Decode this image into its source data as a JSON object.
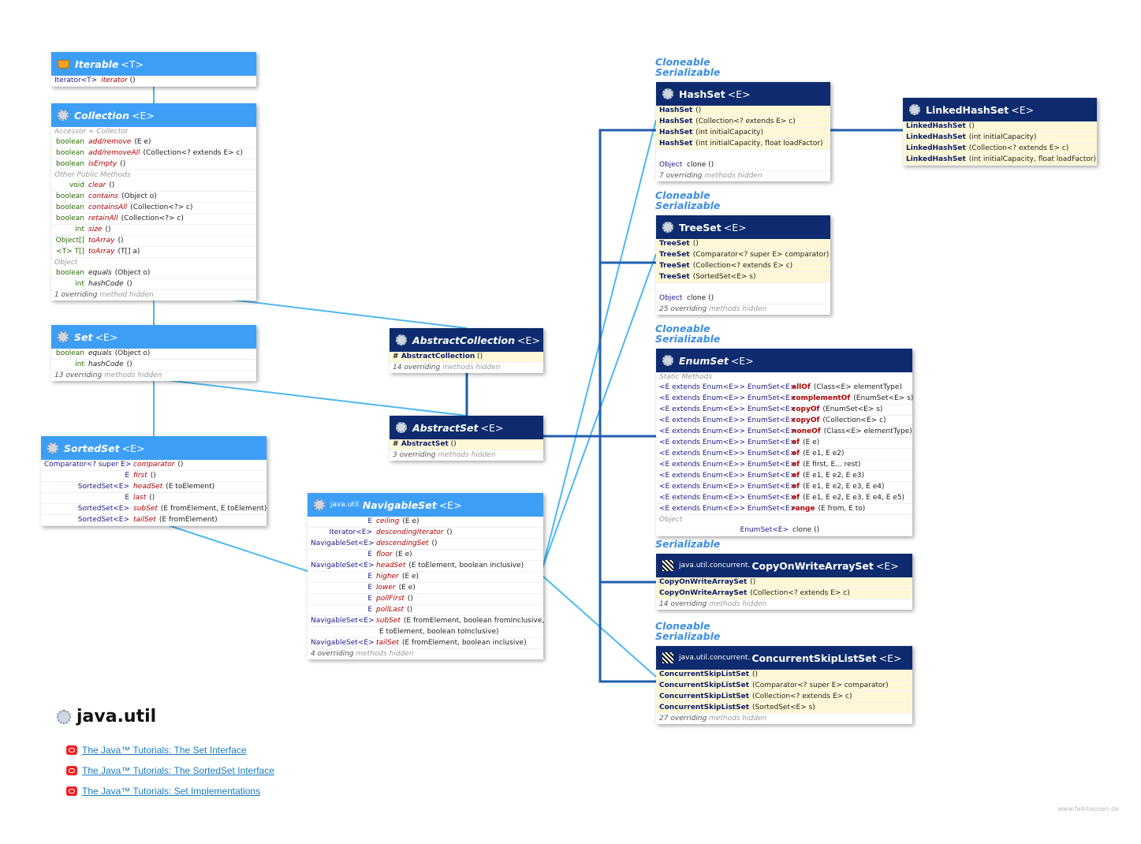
{
  "iterable": {
    "name": "Iterable",
    "tp": "<T>",
    "rows": [
      {
        "ret": "Iterator<T>",
        "m": "iterator",
        "a": "()"
      }
    ]
  },
  "collection": {
    "name": "Collection",
    "tp": "<E>",
    "sec1": "Accessor + Collector",
    "rows1": [
      {
        "ret": "boolean",
        "m": "add/remove",
        "a": "(E e)"
      },
      {
        "ret": "boolean",
        "m": "add/removeAll",
        "a": "(Collection<? extends E> c)"
      },
      {
        "ret": "boolean",
        "m": "isEmpty",
        "a": "()"
      }
    ],
    "sec2": "Other Public Methods",
    "rows2": [
      {
        "ret": "void",
        "m": "clear",
        "a": "()"
      },
      {
        "ret": "boolean",
        "m": "contains",
        "a": "(Object o)"
      },
      {
        "ret": "boolean",
        "m": "containsAll",
        "a": "(Collection<?> c)"
      },
      {
        "ret": "boolean",
        "m": "retainAll",
        "a": "(Collection<?> c)"
      },
      {
        "ret": "int",
        "m": "size",
        "a": "()"
      },
      {
        "ret": "Object[]",
        "m": "toArray",
        "a": "()"
      },
      {
        "ret": "<T> T[]",
        "m": "toArray",
        "a": "(T[] a)"
      }
    ],
    "sec3": "Object",
    "rows3": [
      {
        "ret": "boolean",
        "m": "equals",
        "a": "(Object o)"
      },
      {
        "ret": "int",
        "m": "hashCode",
        "a": "()"
      }
    ],
    "foot": "1 overriding",
    "foot2": "method hidden"
  },
  "set": {
    "name": "Set",
    "tp": "<E>",
    "rows": [
      {
        "ret": "boolean",
        "m": "equals",
        "a": "(Object o)"
      },
      {
        "ret": "int",
        "m": "hashCode",
        "a": "()"
      }
    ],
    "foot": "13 overriding",
    "foot2": "methods hidden"
  },
  "sortedset": {
    "name": "SortedSet",
    "tp": "<E>",
    "rows": [
      {
        "ret": "Comparator<? super E>",
        "m": "comparator",
        "a": "()"
      },
      {
        "ret": "E",
        "m": "first",
        "a": "()"
      },
      {
        "ret": "SortedSet<E>",
        "m": "headSet",
        "a": "(E toElement)"
      },
      {
        "ret": "E",
        "m": "last",
        "a": "()"
      },
      {
        "ret": "SortedSet<E>",
        "m": "subSet",
        "a": "(E fromElement, E toElement)"
      },
      {
        "ret": "SortedSet<E>",
        "m": "tailSet",
        "a": "(E fromElement)"
      }
    ]
  },
  "abstractcollection": {
    "name": "AbstractCollection",
    "tp": "<E>",
    "ctor": "AbstractCollection",
    "ctora": "()",
    "foot": "14 overriding",
    "foot2": "methods hidden"
  },
  "abstractset": {
    "name": "AbstractSet",
    "tp": "<E>",
    "ctor": "AbstractSet",
    "ctora": "()",
    "foot": "3 overriding",
    "foot2": "methods hidden"
  },
  "navigableset": {
    "pkg": "java.util.",
    "name": "NavigableSet",
    "tp": "<E>",
    "rows": [
      {
        "ret": "E",
        "m": "ceiling",
        "a": "(E e)"
      },
      {
        "ret": "Iterator<E>",
        "m": "descendingIterator",
        "a": "()"
      },
      {
        "ret": "NavigableSet<E>",
        "m": "descendingSet",
        "a": "()"
      },
      {
        "ret": "E",
        "m": "floor",
        "a": "(E e)"
      },
      {
        "ret": "NavigableSet<E>",
        "m": "headSet",
        "a": "(E toElement, boolean inclusive)"
      },
      {
        "ret": "E",
        "m": "higher",
        "a": "(E e)"
      },
      {
        "ret": "E",
        "m": "lower",
        "a": "(E e)"
      },
      {
        "ret": "E",
        "m": "pollFirst",
        "a": "()"
      },
      {
        "ret": "E",
        "m": "pollLast",
        "a": "()"
      },
      {
        "ret": "NavigableSet<E>",
        "m": "subSet",
        "a": "(E fromElement, boolean fromInclusive,"
      },
      {
        "ret": "",
        "m": "",
        "a": "E toElement, boolean toInclusive)"
      },
      {
        "ret": "NavigableSet<E>",
        "m": "tailSet",
        "a": "(E fromElement, boolean inclusive)"
      }
    ],
    "foot": "4 overriding",
    "foot2": "methods hidden"
  },
  "hashset": {
    "deco1": "Cloneable",
    "deco2": "Serializable",
    "name": "HashSet",
    "tp": "<E>",
    "ctors": [
      {
        "n": "HashSet",
        "a": "()"
      },
      {
        "n": "HashSet",
        "a": "(Collection<? extends E> c)"
      },
      {
        "n": "HashSet",
        "a": "(int initialCapacity)"
      },
      {
        "n": "HashSet",
        "a": "(int initialCapacity, float loadFactor)"
      }
    ],
    "rows": [
      {
        "ret": "Object",
        "m": "clone",
        "a": "()"
      }
    ],
    "foot": "7 overriding",
    "foot2": "methods hidden"
  },
  "linkedhashset": {
    "name": "LinkedHashSet",
    "tp": "<E>",
    "ctors": [
      {
        "n": "LinkedHashSet",
        "a": "()"
      },
      {
        "n": "LinkedHashSet",
        "a": "(int initialCapacity)"
      },
      {
        "n": "LinkedHashSet",
        "a": "(Collection<? extends E> c)"
      },
      {
        "n": "LinkedHashSet",
        "a": "(int initialCapacity, float loadFactor)"
      }
    ]
  },
  "treeset": {
    "deco1": "Cloneable",
    "deco2": "Serializable",
    "name": "TreeSet",
    "tp": "<E>",
    "ctors": [
      {
        "n": "TreeSet",
        "a": "()"
      },
      {
        "n": "TreeSet",
        "a": "(Comparator<? super E> comparator)"
      },
      {
        "n": "TreeSet",
        "a": "(Collection<? extends E> c)"
      },
      {
        "n": "TreeSet",
        "a": "(SortedSet<E> s)"
      }
    ],
    "rows": [
      {
        "ret": "Object",
        "m": "clone",
        "a": "()"
      }
    ],
    "foot": "25 overriding",
    "foot2": "methods hidden"
  },
  "enumset": {
    "deco1": "Cloneable",
    "deco2": "Serializable",
    "name": "EnumSet",
    "tp": "<E>",
    "sec1": "Static Methods",
    "pre": "<E extends Enum<E>> EnumSet<E>",
    "rows": [
      {
        "m": "allOf",
        "a": "(Class<E> elementType)"
      },
      {
        "m": "complementOf",
        "a": "(EnumSet<E> s)"
      },
      {
        "m": "copyOf",
        "a": "(EnumSet<E> s)"
      },
      {
        "m": "copyOf",
        "a": "(Collection<E> c)"
      },
      {
        "m": "noneOf",
        "a": "(Class<E> elementType)"
      },
      {
        "m": "of",
        "a": "(E e)"
      },
      {
        "m": "of",
        "a": "(E e1, E e2)"
      },
      {
        "m": "of",
        "a": "(E first, E... rest)"
      },
      {
        "m": "of",
        "a": "(E e1, E e2, E e3)"
      },
      {
        "m": "of",
        "a": "(E e1, E e2, E e3, E e4)"
      },
      {
        "m": "of",
        "a": "(E e1, E e2, E e3, E e4, E e5)"
      },
      {
        "m": "range",
        "a": "(E from, E to)"
      }
    ],
    "sec2": "Object",
    "clone": {
      "ret": "EnumSet<E>",
      "m": "clone",
      "a": "()"
    }
  },
  "cowas": {
    "deco1": "Serializable",
    "pkg": "java.util.concurrent.",
    "name": "CopyOnWriteArraySet",
    "tp": "<E>",
    "ctors": [
      {
        "n": "CopyOnWriteArraySet",
        "a": "()"
      },
      {
        "n": "CopyOnWriteArraySet",
        "a": "(Collection<? extends E> c)"
      }
    ],
    "foot": "14 overriding",
    "foot2": "methods hidden"
  },
  "csls": {
    "deco1": "Cloneable",
    "deco2": "Serializable",
    "pkg": "java.util.concurrent.",
    "name": "ConcurrentSkipListSet",
    "tp": "<E>",
    "ctors": [
      {
        "n": "ConcurrentSkipListSet",
        "a": "()"
      },
      {
        "n": "ConcurrentSkipListSet",
        "a": "(Comparator<? super E> comparator)"
      },
      {
        "n": "ConcurrentSkipListSet",
        "a": "(Collection<? extends E> c)"
      },
      {
        "n": "ConcurrentSkipListSet",
        "a": "(SortedSet<E> s)"
      }
    ],
    "foot": "27 overriding",
    "foot2": "methods hidden"
  },
  "title": "java.util",
  "links": [
    "The Java™ Tutorials: The Set Interface",
    "The Java™ Tutorials: The SortedSet Interface",
    "The Java™ Tutorials: Set Implementations"
  ],
  "watermark": "www.falkhausen.de",
  "colors": {
    "interface": "#3d9ef5",
    "class": "#0d2b6e",
    "ctorbg": "#fff8d6",
    "link": "#1a7bc0",
    "impl": "#1f5fb0",
    "ext": "#4db8f0"
  }
}
